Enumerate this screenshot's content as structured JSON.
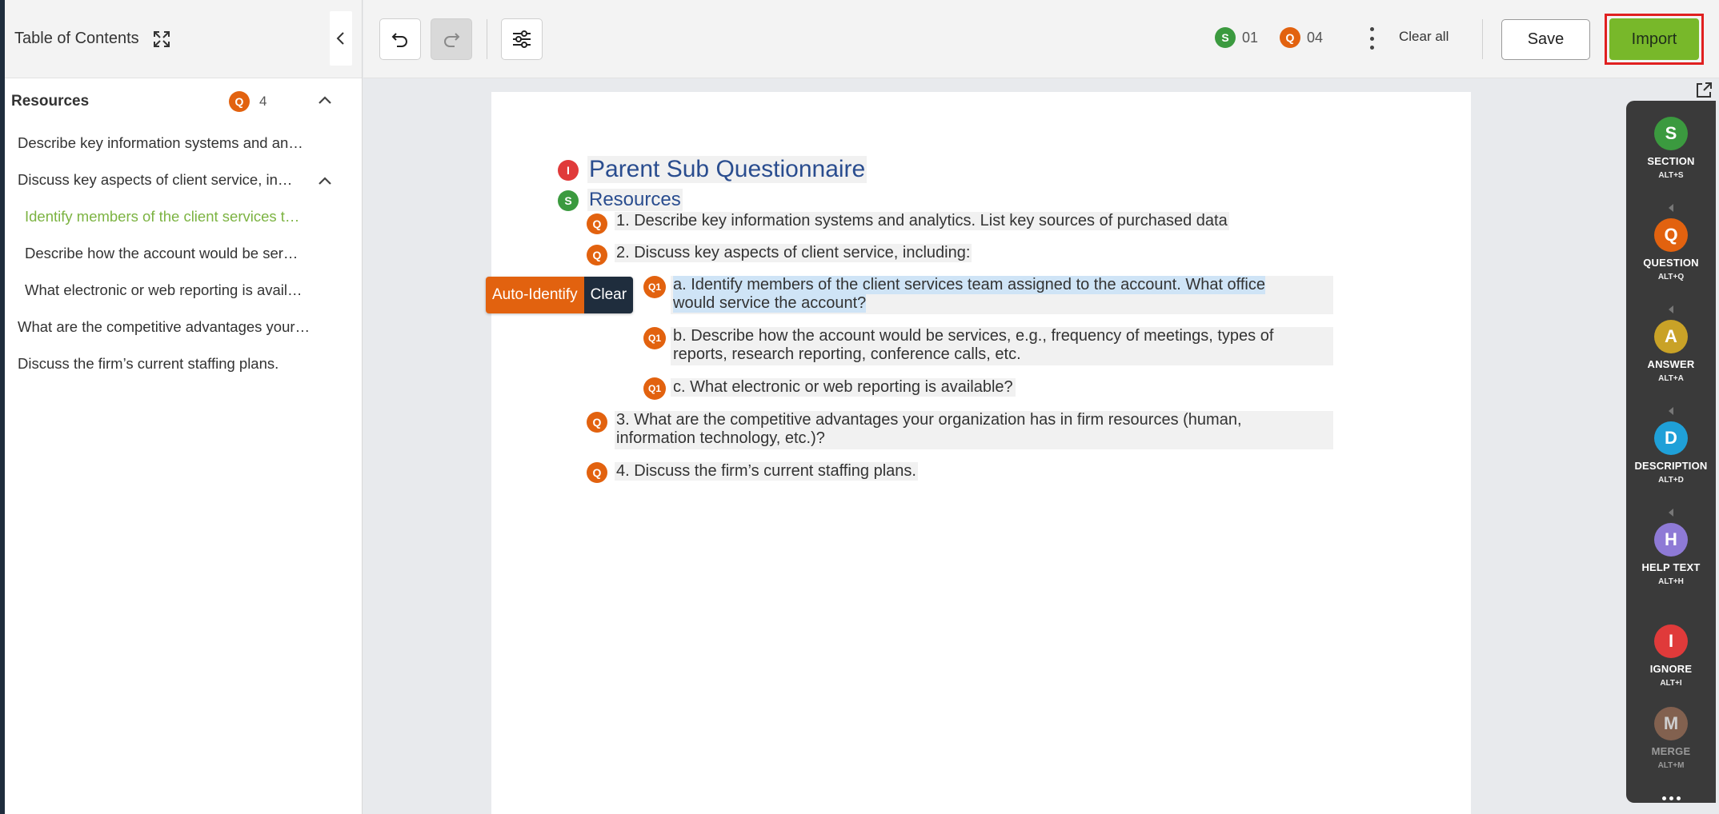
{
  "sidebar": {
    "title": "Table of Contents",
    "section": {
      "name": "Resources",
      "badge": "Q",
      "count": "4"
    },
    "items": [
      {
        "label": "Describe key information systems and analytics. List key sources of purchased data"
      },
      {
        "label": "Discuss key aspects of client service, including:"
      },
      {
        "label": "Identify members of the client services team assigned to the account. What office would service the account?"
      },
      {
        "label": "Describe how the account would be services, e.g., frequency of meetings"
      },
      {
        "label": "What electronic or web reporting is available?"
      },
      {
        "label": "What are the competitive advantages your organization has in firm resources"
      },
      {
        "label": "Discuss the firm’s current staffing plans."
      }
    ]
  },
  "toolbar": {
    "section_badge": "S",
    "section_count": "01",
    "question_badge": "Q",
    "question_count": "04",
    "clear_all": "Clear all",
    "save": "Save",
    "import": "Import"
  },
  "document": {
    "title_badge": "I",
    "title": "Parent Sub Questionnaire",
    "section_badge": "S",
    "section": "Resources",
    "q_badge": "Q",
    "sub_badge": "Q1",
    "q1": "1.  Describe key information systems and analytics. List key sources of purchased data",
    "q2": "2.  Discuss key aspects of client service, including:",
    "q2a_line1": "a.  Identify members of the client services team assigned to the account. What office",
    "q2a_line2": "would service the account?",
    "q2b_line1": "b.  Describe how the account would be services, e.g., frequency of meetings, types of",
    "q2b_line2": "reports, research reporting, conference calls, etc.",
    "q2c": "c.  What electronic or web reporting is available?",
    "q3_line1": "3.  What are the competitive advantages your organization has in firm resources (human,",
    "q3_line2": "information technology, etc.)?",
    "q4": "4.  Discuss the firm’s current staffing plans.",
    "auto_identify": "Auto-Identify",
    "clear": "Clear"
  },
  "tools": [
    {
      "letter": "S",
      "name": "SECTION",
      "key": "ALT+S",
      "color": "#3b9a3f"
    },
    {
      "letter": "Q",
      "name": "QUESTION",
      "key": "ALT+Q",
      "color": "#e2620f"
    },
    {
      "letter": "A",
      "name": "ANSWER",
      "key": "ALT+A",
      "color": "#c9a227"
    },
    {
      "letter": "D",
      "name": "DESCRIPTION",
      "key": "ALT+D",
      "color": "#1fa0d8"
    },
    {
      "letter": "H",
      "name": "HELP TEXT",
      "key": "ALT+H",
      "color": "#8e7ad6"
    },
    {
      "letter": "I",
      "name": "IGNORE",
      "key": "ALT+I",
      "color": "#e03a3a"
    },
    {
      "letter": "M",
      "name": "MERGE",
      "key": "ALT+M",
      "color": "#9b6e57"
    }
  ],
  "colors": {
    "accent_green": "#78b82a",
    "question_orange": "#e2620f",
    "section_green": "#3b9a3f",
    "ignore_red": "#e03a3a",
    "doc_blue": "#2a4d8f",
    "highlight": "#cfe4f6",
    "active_toc": "#7cb342"
  }
}
